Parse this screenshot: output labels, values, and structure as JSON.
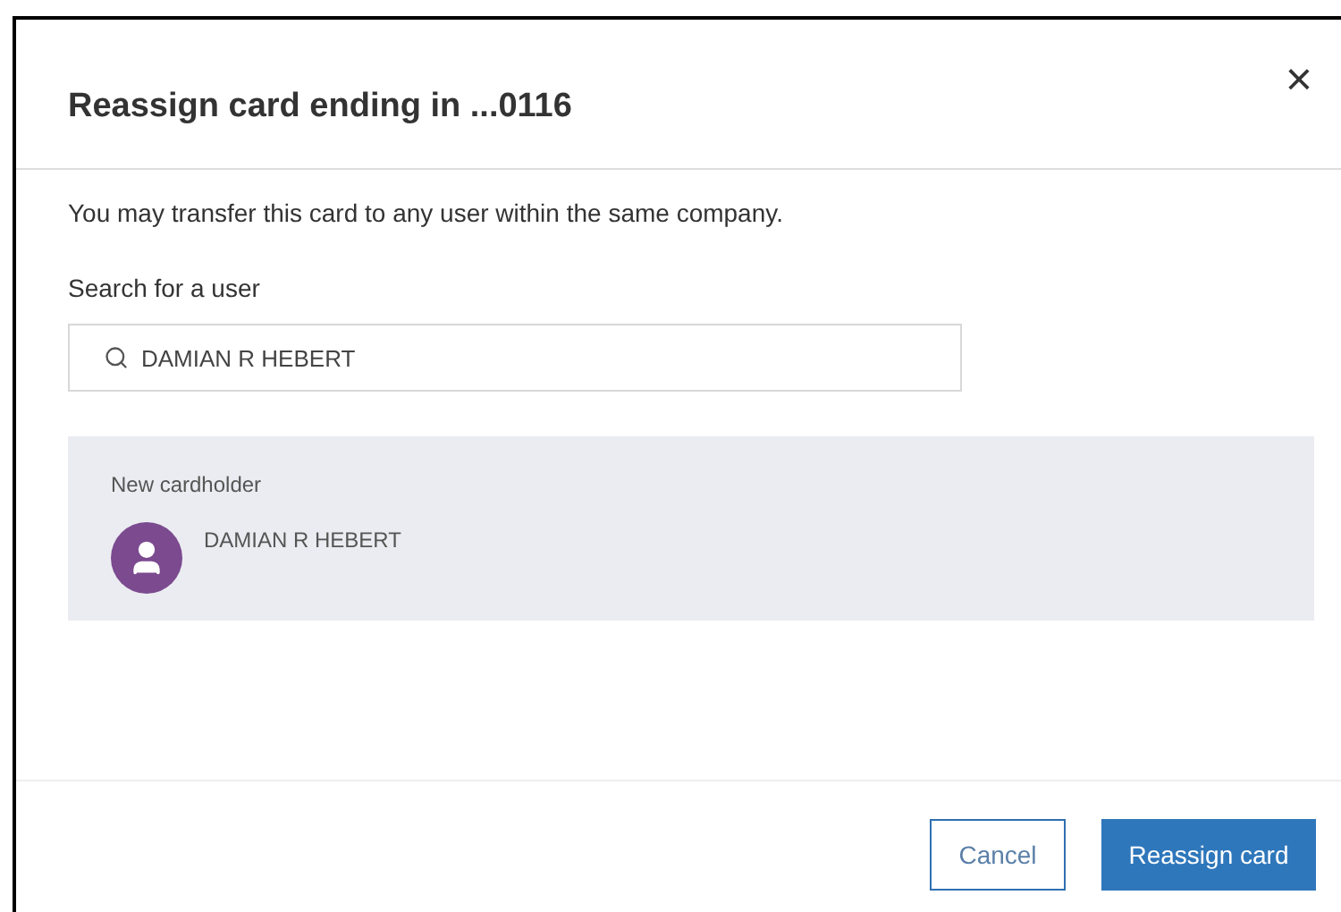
{
  "dialog": {
    "title": "Reassign card ending in ...0116",
    "close": "×"
  },
  "intro": "You may transfer this card to any user within the same company.",
  "search": {
    "label": "Search for a user",
    "value": "DAMIAN R HEBERT"
  },
  "result": {
    "heading": "New cardholder",
    "name": "DAMIAN R HEBERT"
  },
  "buttons": [
    {
      "label": "Cancel",
      "kind": "secondary"
    },
    {
      "label": "Reassign card",
      "kind": "primary"
    }
  ]
}
